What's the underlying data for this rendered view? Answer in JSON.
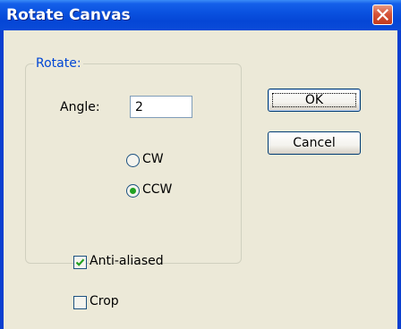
{
  "window": {
    "title": "Rotate Canvas",
    "close_icon": "close-icon"
  },
  "rotate_group": {
    "legend": "Rotate:",
    "angle_label": "Angle:",
    "angle_value": "2",
    "direction_options": [
      {
        "label": "CW",
        "selected": false
      },
      {
        "label": "CCW",
        "selected": true
      }
    ]
  },
  "options": {
    "anti_aliased": {
      "label": "Anti-aliased",
      "checked": true
    },
    "crop": {
      "label": "Crop",
      "checked": false
    }
  },
  "buttons": {
    "ok": "OK",
    "cancel": "Cancel"
  },
  "colors": {
    "title_bar": "#0a52e0",
    "dialog_face": "#ece9d8",
    "group_legend": "#0046d5",
    "radio_dot": "#21a121",
    "check_mark": "#21a121",
    "close_button": "#d6553a"
  }
}
